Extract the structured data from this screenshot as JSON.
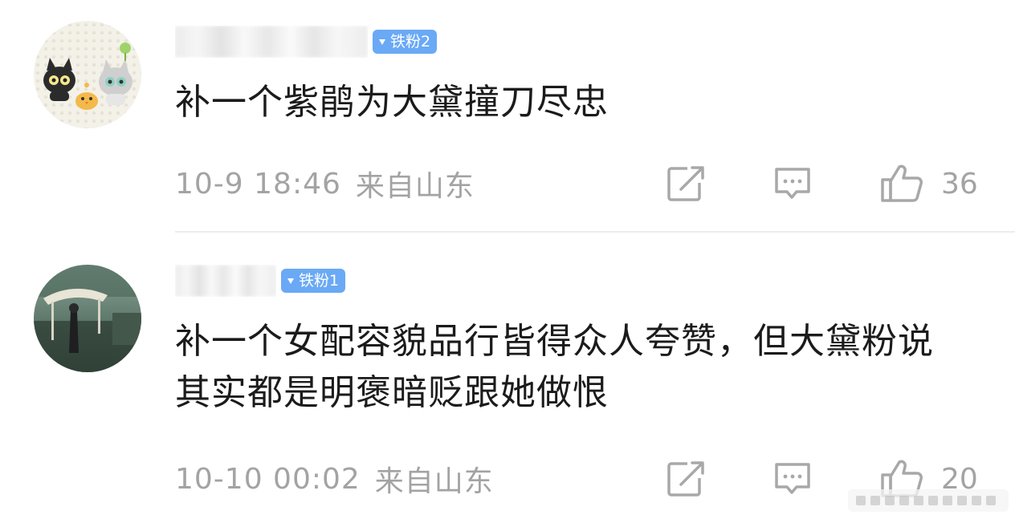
{
  "comments": [
    {
      "username": "",
      "badge": "铁粉2",
      "content": "补一个紫鹃为大黛撞刀尽忠",
      "timestamp": "10-9 18:46",
      "location": "来自山东",
      "likes": "36"
    },
    {
      "username": "",
      "badge": "铁粉1",
      "content": "补一个女配容貌品行皆得众人夸赞，但大黛粉说其实都是明褒暗贬跟她做恨",
      "timestamp": "10-10 00:02",
      "location": "来自山东",
      "likes": "20"
    }
  ],
  "colors": {
    "badge": "#6aa9f5",
    "meta": "#a3a3a3",
    "text": "#1b1b1b",
    "divider": "#ededed"
  },
  "icons": [
    "share-icon",
    "comment-icon",
    "thumbs-up-icon",
    "badge-icon",
    "watermark-icon"
  ]
}
